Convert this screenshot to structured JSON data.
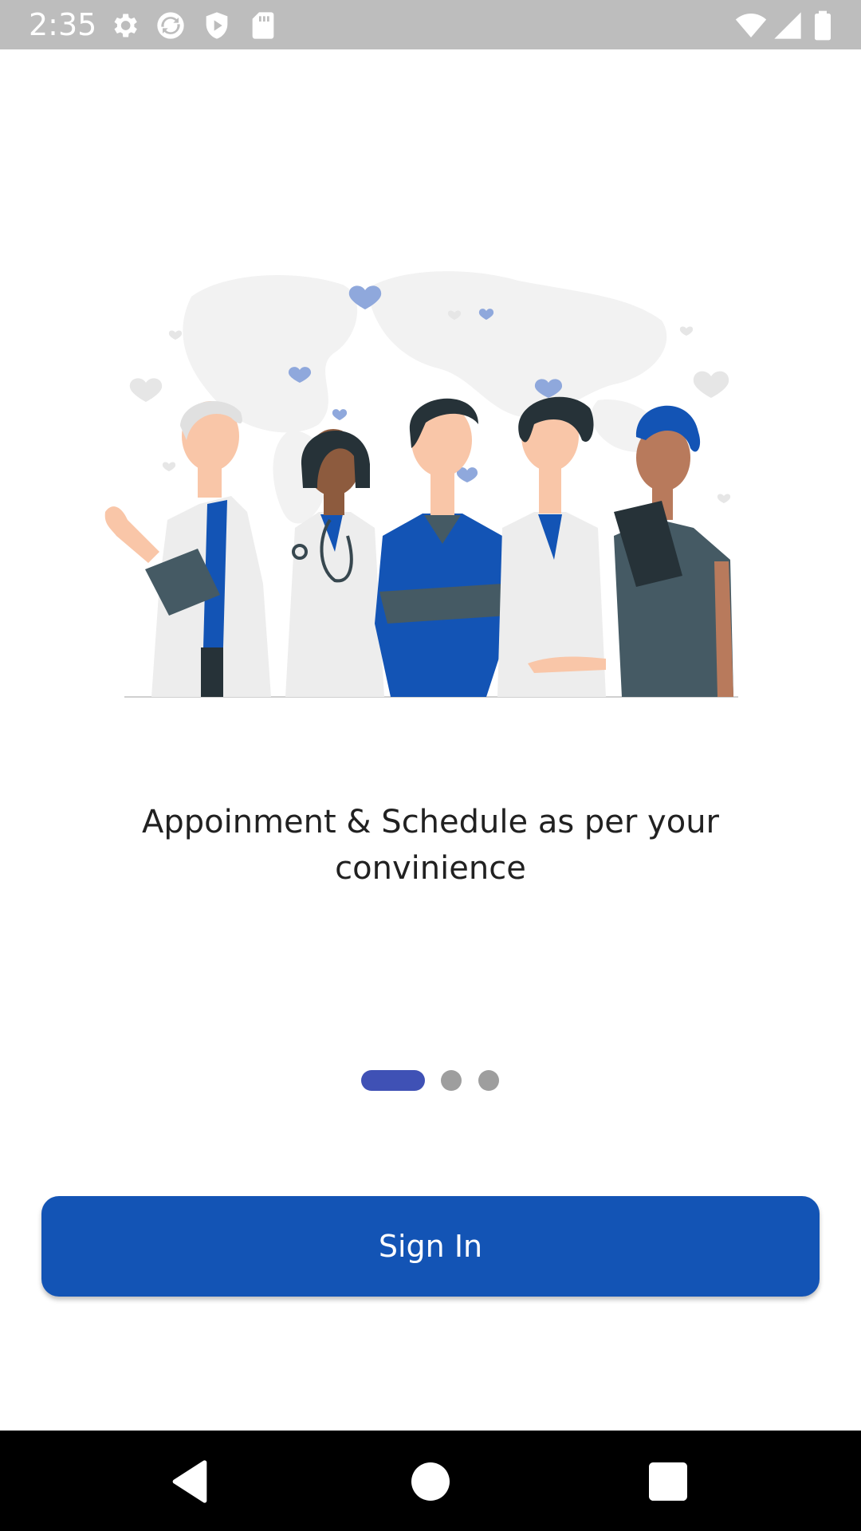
{
  "status_bar": {
    "time": "2:35",
    "icons_left": [
      "gear-icon",
      "sync-icon",
      "shield-play-icon",
      "sd-card-icon"
    ],
    "icons_right": [
      "wifi-icon",
      "cell-signal-icon",
      "battery-icon"
    ]
  },
  "onboarding": {
    "illustration": "medical-staff-illustration",
    "headline": "Appoinment & Schedule as per your convinience",
    "page_indicator": {
      "total": 3,
      "active": 1
    }
  },
  "actions": {
    "sign_in_label": "Sign In"
  },
  "nav_bar": {
    "buttons": [
      "back-icon",
      "home-icon",
      "recents-icon"
    ]
  },
  "colors": {
    "primary": "#1354b5",
    "indicator_active": "#3f51b5",
    "indicator_inactive": "#9e9e9e",
    "status_bar": "#bdbdbd"
  }
}
